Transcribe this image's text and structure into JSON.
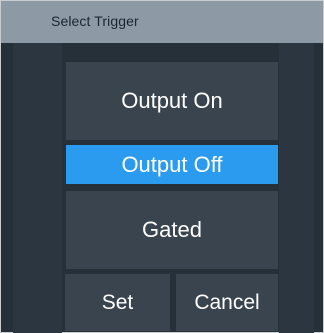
{
  "dialog": {
    "title": "Select Trigger"
  },
  "options": [
    {
      "label": "Output On",
      "selected": false
    },
    {
      "label": "Output Off",
      "selected": true
    },
    {
      "label": "Gated",
      "selected": false
    }
  ],
  "buttons": {
    "set_label": "Set",
    "cancel_label": "Cancel"
  },
  "colors": {
    "selection_accent": "#2a9bee",
    "titlebar": "#8d9aa6",
    "background": "#263039",
    "item": "#39444f"
  }
}
